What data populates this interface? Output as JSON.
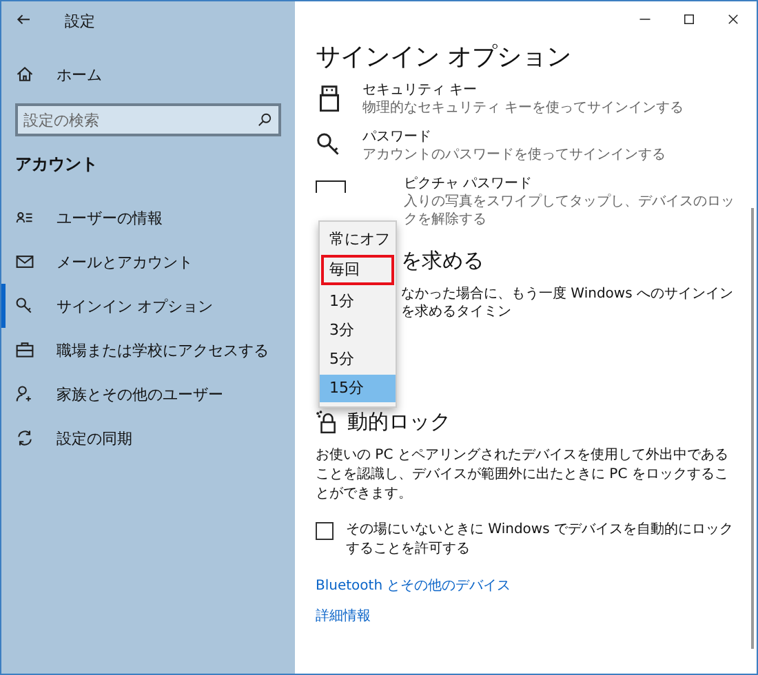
{
  "window": {
    "title": "設定"
  },
  "sidebar": {
    "home": "ホーム",
    "search": {
      "placeholder": "設定の検索"
    },
    "section": "アカウント",
    "items": [
      {
        "label": "ユーザーの情報",
        "selected": false
      },
      {
        "label": "メールとアカウント",
        "selected": false
      },
      {
        "label": "サインイン オプション",
        "selected": true
      },
      {
        "label": "職場または学校にアクセスする",
        "selected": false
      },
      {
        "label": "家族とその他のユーザー",
        "selected": false
      },
      {
        "label": "設定の同期",
        "selected": false
      }
    ]
  },
  "main": {
    "title": "サインイン オプション",
    "options": [
      {
        "kind": "full",
        "title": "セキュリティ キー",
        "description": "物理的なセキュリティ キーを使ってサインインする"
      },
      {
        "kind": "full",
        "title": "パスワード",
        "description": "アカウントのパスワードを使ってサインインする"
      },
      {
        "kind": "covered",
        "title": "ピクチャ パスワード",
        "description": "入りの写真をスワイプしてタップし、デバイスのロックを解除する"
      }
    ],
    "require_signin": {
      "heading": "を求める",
      "description": "なかった場合に、もう一度 Windows へのサインインを求めるタイミン"
    },
    "dropdown": [
      {
        "label": "常にオフ",
        "selected": false,
        "highlighted": false
      },
      {
        "label": "毎回",
        "selected": false,
        "highlighted": true
      },
      {
        "label": "1分",
        "selected": false,
        "highlighted": false
      },
      {
        "label": "3分",
        "selected": false,
        "highlighted": false
      },
      {
        "label": "5分",
        "selected": false,
        "highlighted": false
      },
      {
        "label": "15分",
        "selected": true,
        "highlighted": false
      }
    ],
    "dynamic_lock": {
      "heading": "動的ロック",
      "description": "お使いの PC とペアリングされたデバイスを使用して外出中であることを認識し、デバイスが範囲外に出たときに PC をロックすることができます。",
      "checkbox": {
        "label": "その場にいないときに Windows でデバイスを自動的にロックすることを許可する",
        "checked": false
      },
      "links": [
        "Bluetooth とその他のデバイス",
        "詳細情報"
      ]
    }
  }
}
